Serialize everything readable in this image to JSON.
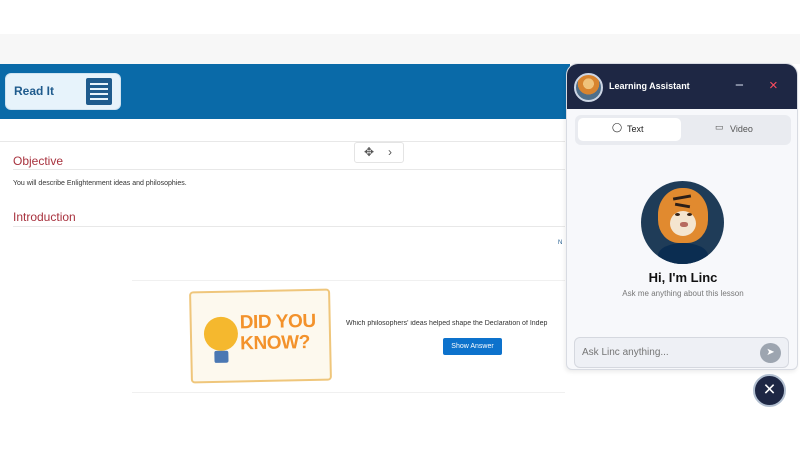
{
  "lesson": {
    "read_it_label": "Read It",
    "objective_title": "Objective",
    "objective_text": "You will describe Enlightenment ideas and philosophies.",
    "introduction_title": "Introduction",
    "truncated_link": "N",
    "did_you_know": "DID YOU KNOW?",
    "question": "Which philosophers' ideas helped shape the Declaration of Indep",
    "show_answer": "Show Answer",
    "toolbar_move_icon": "✥",
    "toolbar_next_icon": "›"
  },
  "assistant": {
    "title": "Learning Assistant",
    "minimize_icon": "−",
    "close_icon": "×",
    "tabs": [
      {
        "label": "Text",
        "icon": "chat-icon",
        "glyph": "◯",
        "active": true
      },
      {
        "label": "Video",
        "icon": "video-icon",
        "glyph": "▭",
        "active": false
      }
    ],
    "greeting": "Hi, I'm Linc",
    "subgreeting": "Ask me anything about this lesson",
    "input_placeholder": "Ask Linc anything...",
    "send_icon": "➤",
    "floating_close_icon": "×"
  },
  "colors": {
    "header_blue": "#0a6aa8",
    "section_red": "#a8323e",
    "assistant_navy": "#1e2744",
    "button_blue": "#0d72cc"
  }
}
